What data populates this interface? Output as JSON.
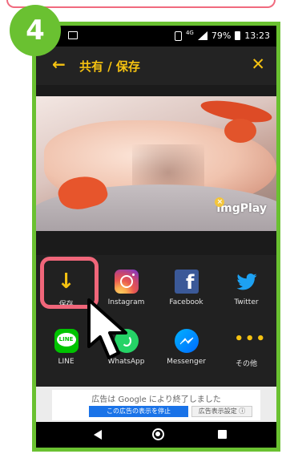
{
  "step": {
    "number": "4"
  },
  "status": {
    "network": "4G",
    "battery": "79%",
    "time": "13:23"
  },
  "appbar": {
    "back_icon": "←",
    "title": "共有 / 保存",
    "close_icon": "✕"
  },
  "image": {
    "watermark": "imgPlay"
  },
  "share_items": [
    {
      "label": "保存",
      "icon": "download-icon"
    },
    {
      "label": "Instagram",
      "icon": "instagram-icon"
    },
    {
      "label": "Facebook",
      "icon": "facebook-icon"
    },
    {
      "label": "Twitter",
      "icon": "twitter-icon"
    },
    {
      "label": "LINE",
      "icon": "line-icon"
    },
    {
      "label": "WhatsApp",
      "icon": "whatsapp-icon"
    },
    {
      "label": "Messenger",
      "icon": "messenger-icon"
    },
    {
      "label": "その他",
      "icon": "more-icon"
    }
  ],
  "icon_glyphs": {
    "line": "LINE",
    "facebook": "f",
    "save": "↓",
    "more": "•••",
    "twitter": "🐦"
  },
  "ad": {
    "message": "広告は Google により終了しました",
    "stop_button": "この広告の表示を停止",
    "settings_button": "広告表示設定 ⓘ"
  },
  "colors": {
    "accent": "#f5c211",
    "frame_green": "#6ac131",
    "highlight_pink": "#f0667a"
  }
}
